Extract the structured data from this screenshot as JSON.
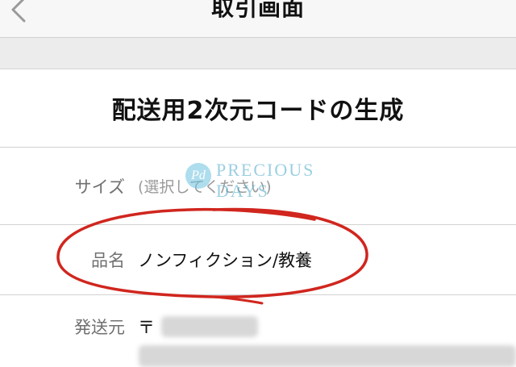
{
  "navbar": {
    "title": "取引画面",
    "back_icon": "chevron-left-icon"
  },
  "section": {
    "title": "配送用2次元コードの生成"
  },
  "rows": [
    {
      "label": "サイズ",
      "value": "(選択してください)"
    },
    {
      "label": "品名",
      "value": "ノンフィクション/教養"
    },
    {
      "label": "発送元",
      "value": "〒"
    }
  ],
  "watermark": {
    "line1": "PRECIOUS",
    "line2": "DAYS",
    "mark": "Pd"
  },
  "colors": {
    "annotation_red": "#d0261e",
    "label_gray": "#707070",
    "watermark_blue": "#4aa8c8"
  }
}
